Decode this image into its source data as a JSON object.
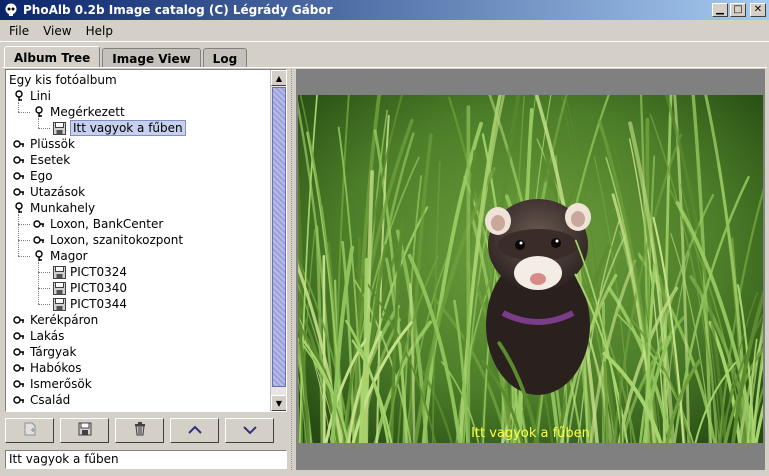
{
  "window": {
    "title": "PhoAlb 0.2b Image catalog (C) Légrády Gábor"
  },
  "menu": [
    "File",
    "View",
    "Help"
  ],
  "tabs": [
    "Album Tree",
    "Image View",
    "Log"
  ],
  "tree": {
    "root": "Egy kis fotóalbum",
    "rows": [
      {
        "label": "Lini",
        "level": 0,
        "type": "folder",
        "expanded": true
      },
      {
        "label": "Megérkezett",
        "level": 1,
        "type": "folder",
        "expanded": true
      },
      {
        "label": "Itt vagyok a fűben",
        "level": 2,
        "type": "image",
        "selected": true
      },
      {
        "label": "Plüssök",
        "level": 0,
        "type": "folder"
      },
      {
        "label": "Esetek",
        "level": 0,
        "type": "folder"
      },
      {
        "label": "Ego",
        "level": 0,
        "type": "folder"
      },
      {
        "label": "Utazások",
        "level": 0,
        "type": "folder"
      },
      {
        "label": "Munkahely",
        "level": 0,
        "type": "folder",
        "expanded": true
      },
      {
        "label": "Loxon, BankCenter",
        "level": 1,
        "type": "folder"
      },
      {
        "label": "Loxon, szanitokozpont",
        "level": 1,
        "type": "folder"
      },
      {
        "label": "Magor",
        "level": 1,
        "type": "folder",
        "expanded": true
      },
      {
        "label": "PICT0324",
        "level": 2,
        "type": "image"
      },
      {
        "label": "PICT0340",
        "level": 2,
        "type": "image"
      },
      {
        "label": "PICT0344",
        "level": 2,
        "type": "image"
      },
      {
        "label": "Kerékpáron",
        "level": 0,
        "type": "folder"
      },
      {
        "label": "Lakás",
        "level": 0,
        "type": "folder"
      },
      {
        "label": "Tárgyak",
        "level": 0,
        "type": "folder"
      },
      {
        "label": "Habókos",
        "level": 0,
        "type": "folder"
      },
      {
        "label": "Ismerősök",
        "level": 0,
        "type": "folder"
      },
      {
        "label": "Család",
        "level": 0,
        "type": "folder"
      }
    ]
  },
  "toolbar": {
    "buttons": [
      "new-image-icon",
      "save-icon",
      "trash-icon",
      "chevron-up-icon",
      "chevron-down-icon"
    ]
  },
  "status": {
    "value": "Itt vagyok a fűben"
  },
  "image_view": {
    "caption": "Itt vagyok a fűben"
  }
}
